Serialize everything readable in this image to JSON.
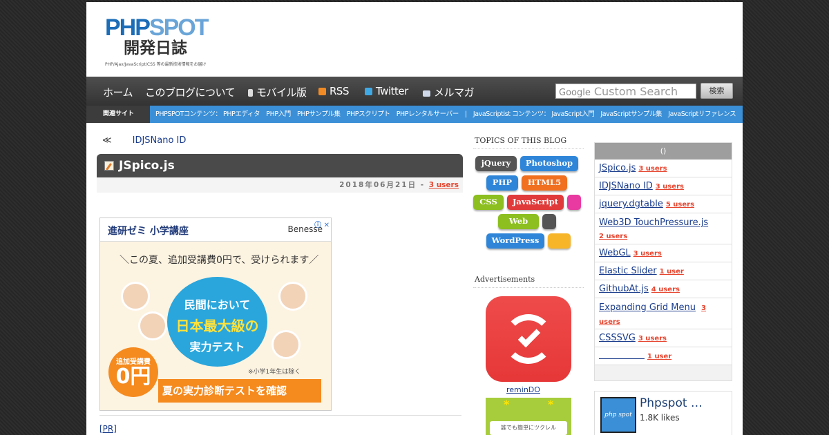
{
  "header": {
    "logo_line1_a": "PHP",
    "logo_line1_b": "SPOT",
    "logo_line2": "開発日誌",
    "logo_tagline": "PHP/Ajax/JavaScript/CSS 等の最新技術情報をお届け"
  },
  "nav": {
    "items": [
      "ホーム",
      "このブログについて",
      "モバイル版",
      "RSS",
      "Twitter",
      "メルマガ"
    ],
    "search_placeholder": "Custom Search",
    "search_brand": "Google",
    "search_button": "検索"
  },
  "subnav": {
    "label": "関連サイト",
    "links_text": "PHPSPOTコンテンツ： PHPエディタ　PHP入門　PHPサンプル集　PHPスクリプト　PHPレンタルサーバー　|　JavaScriptist コンテンツ： JavaScript入門　JavaScriptサンプル集　JavaScriptリファレンス"
  },
  "entry": {
    "prev_arrow": "≪",
    "prev_title": "IDJSNano ID",
    "title": "JSpico.js",
    "meta_date": "2018年06月21日 -",
    "meta_users": "3 users",
    "pr_label": "[PR]"
  },
  "ad": {
    "title": "進研ゼミ 小学講座",
    "brand": "Benesse",
    "close": "ⓘ ✕",
    "slogan": "＼この夏、追加受講費0円で、受けられます／",
    "circle_a": "民間において",
    "circle_b": "日本最大級の",
    "circle_c": "実力テスト",
    "badge_small": "追加受講費",
    "badge_big": "0円",
    "note": "※小学1年生は除く",
    "cta": "夏の実力診断テストを確認"
  },
  "topics": {
    "heading": "TOPICS OF THIS BLOG",
    "tags": [
      {
        "label": "jQuery",
        "color": "#555555"
      },
      {
        "label": "Photoshop",
        "color": "#2f86d9"
      },
      {
        "label": "PHP",
        "color": "#2f86d9"
      },
      {
        "label": "HTML5",
        "color": "#f07020"
      },
      {
        "label": "CSS",
        "color": "#8cbf1f"
      },
      {
        "label": "JavaScript",
        "color": "#e03a3a"
      },
      {
        "label": "",
        "color": "#e83aa0"
      },
      {
        "label": "Web",
        "color": "#8cbf1f"
      },
      {
        "label": "",
        "color": "#555555"
      },
      {
        "label": "WordPress",
        "color": "#2f86d9"
      },
      {
        "label": "",
        "color": "#f7b52a"
      }
    ]
  },
  "ads_section": {
    "heading": "Advertisements",
    "app_name": "reminDO",
    "app2_text": "誰でも簡単にツクレル"
  },
  "ranking": {
    "heading": "()",
    "rows": [
      {
        "title": "JSpico.js",
        "users": "3 users"
      },
      {
        "title": "IDJSNano ID",
        "users": "3 users"
      },
      {
        "title": "jquery.dgtable",
        "users": "5 users"
      },
      {
        "title": "Web3D TouchPressure.js",
        "users": "2 users"
      },
      {
        "title": "WebGL",
        "users": "3 users"
      },
      {
        "title": "Elastic Slider",
        "users": "1 user"
      },
      {
        "title": "GithubAt.js",
        "users": "4 users"
      },
      {
        "title": "Expanding Grid Menu",
        "users": "3 users"
      },
      {
        "title": "CSSSVG",
        "users": "3 users"
      },
      {
        "title": "",
        "users": "1 user"
      }
    ]
  },
  "facebook": {
    "name": "Phpspot …",
    "likes": "1.8K likes",
    "pic_text": "php spot"
  }
}
